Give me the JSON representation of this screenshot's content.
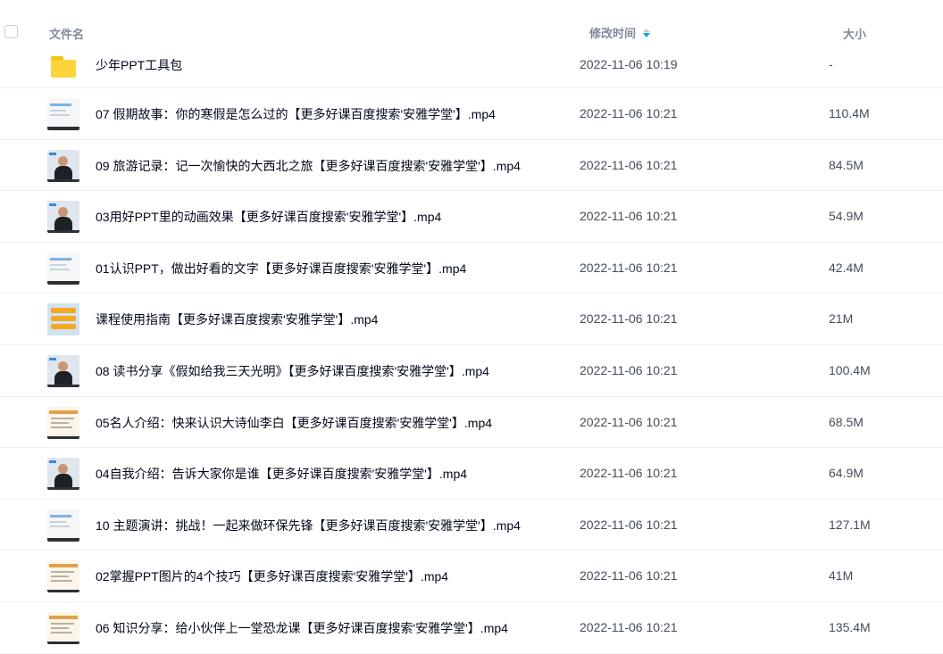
{
  "header": {
    "name_label": "文件名",
    "time_label": "修改时间",
    "size_label": "大小"
  },
  "files": [
    {
      "name": "少年PPT工具包",
      "time": "2022-11-06 10:19",
      "size": "-",
      "thumb": "folder"
    },
    {
      "name": "07 假期故事：你的寒假是怎么过的【更多好课百度搜索'安雅学堂'】.mp4",
      "time": "2022-11-06 10:21",
      "size": "110.4M",
      "thumb": "slide"
    },
    {
      "name": "09 旅游记录：记一次愉快的大西北之旅【更多好课百度搜索'安雅学堂'】.mp4",
      "time": "2022-11-06 10:21",
      "size": "84.5M",
      "thumb": "person"
    },
    {
      "name": "03用好PPT里的动画效果【更多好课百度搜索'安雅学堂'】.mp4",
      "time": "2022-11-06 10:21",
      "size": "54.9M",
      "thumb": "person"
    },
    {
      "name": "01认识PPT，做出好看的文字【更多好课百度搜索'安雅学堂'】.mp4",
      "time": "2022-11-06 10:21",
      "size": "42.4M",
      "thumb": "slide"
    },
    {
      "name": "课程使用指南【更多好课百度搜索'安雅学堂'】.mp4",
      "time": "2022-11-06 10:21",
      "size": "21M",
      "thumb": "guide"
    },
    {
      "name": "08 读书分享《假如给我三天光明》【更多好课百度搜索'安雅学堂'】.mp4",
      "time": "2022-11-06 10:21",
      "size": "100.4M",
      "thumb": "person"
    },
    {
      "name": "05名人介绍：快来认识大诗仙李白【更多好课百度搜索'安雅学堂'】.mp4",
      "time": "2022-11-06 10:21",
      "size": "68.5M",
      "thumb": "doc"
    },
    {
      "name": "04自我介绍：告诉大家你是谁【更多好课百度搜索'安雅学堂'】.mp4",
      "time": "2022-11-06 10:21",
      "size": "64.9M",
      "thumb": "person"
    },
    {
      "name": "10 主题演讲：挑战！一起来做环保先锋【更多好课百度搜索'安雅学堂'】.mp4",
      "time": "2022-11-06 10:21",
      "size": "127.1M",
      "thumb": "slide"
    },
    {
      "name": "02掌握PPT图片的4个技巧【更多好课百度搜索'安雅学堂'】.mp4",
      "time": "2022-11-06 10:21",
      "size": "41M",
      "thumb": "doc"
    },
    {
      "name": "06 知识分享：给小伙伴上一堂恐龙课【更多好课百度搜索'安雅学堂'】.mp4",
      "time": "2022-11-06 10:21",
      "size": "135.4M",
      "thumb": "doc"
    }
  ]
}
